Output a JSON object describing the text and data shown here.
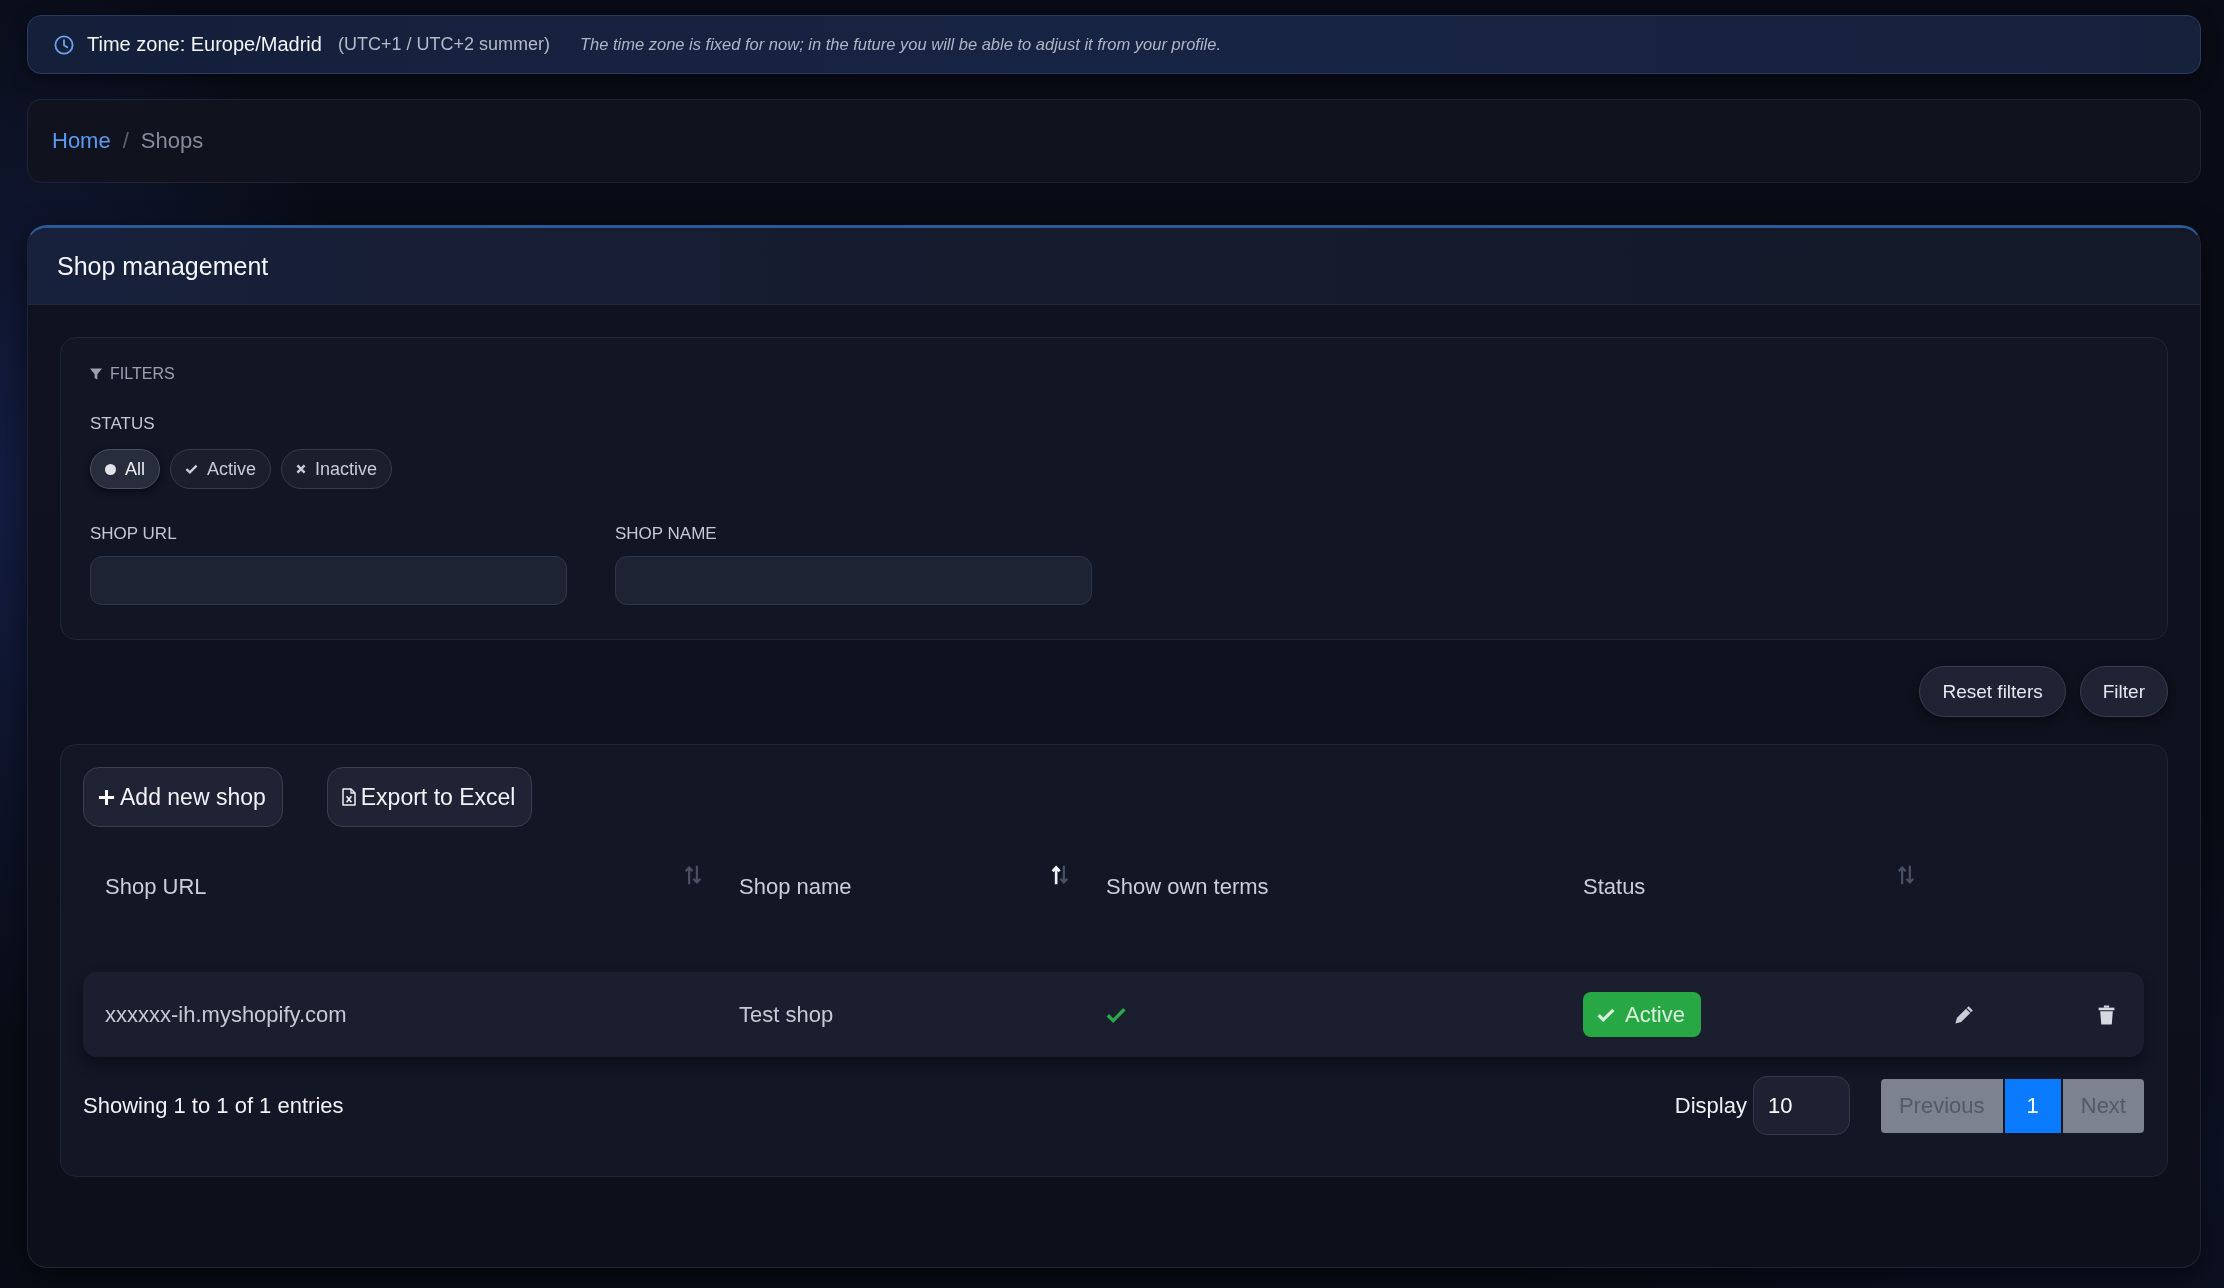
{
  "timezone_banner": {
    "title": "Time zone: Europe/Madrid",
    "offset": "(UTC+1 / UTC+2 summer)",
    "note": "The time zone is fixed for now; in the future you will be able to adjust it from your profile."
  },
  "breadcrumb": {
    "items": [
      {
        "label": "Home",
        "kind": "link"
      },
      {
        "label": "Shops",
        "kind": "current"
      }
    ],
    "separator": "/"
  },
  "card": {
    "title": "Shop management"
  },
  "filters": {
    "heading": "FILTERS",
    "status": {
      "label": "STATUS",
      "options": [
        {
          "label": "All",
          "kind": "all",
          "selected": true
        },
        {
          "label": "Active",
          "kind": "active",
          "selected": false
        },
        {
          "label": "Inactive",
          "kind": "inactive",
          "selected": false
        }
      ]
    },
    "fields": [
      {
        "label": "SHOP URL"
      },
      {
        "label": "SHOP NAME"
      }
    ],
    "buttons": [
      "Reset filters",
      "Filter"
    ]
  },
  "table": {
    "actions": [
      {
        "label": "Add new shop",
        "kind": "add"
      },
      {
        "label": "Export to Excel",
        "kind": "export"
      }
    ],
    "columns": [
      {
        "label": "Shop URL",
        "sortable": true,
        "sorted": false
      },
      {
        "label": "Shop name",
        "sortable": true,
        "sorted": true
      },
      {
        "label": "Show own terms",
        "sortable": false,
        "sorted": false
      },
      {
        "label": "Status",
        "sortable": true,
        "sorted": false
      }
    ],
    "rows": [
      {
        "shop_url": "xxxxxx-ih.myshopify.com",
        "shop_name": "Test shop",
        "show_own_terms": true,
        "status": {
          "label": "Active",
          "kind": "active"
        }
      }
    ],
    "footer": {
      "summary": "Showing 1 to 1 of 1 entries",
      "page_size_label": "Display",
      "page_size": "10",
      "pagination": {
        "previous": {
          "label": "Previous",
          "disabled": true
        },
        "pages": [
          {
            "label": "1",
            "selected": true
          }
        ],
        "next": {
          "label": "Next",
          "disabled": true
        }
      }
    }
  }
}
